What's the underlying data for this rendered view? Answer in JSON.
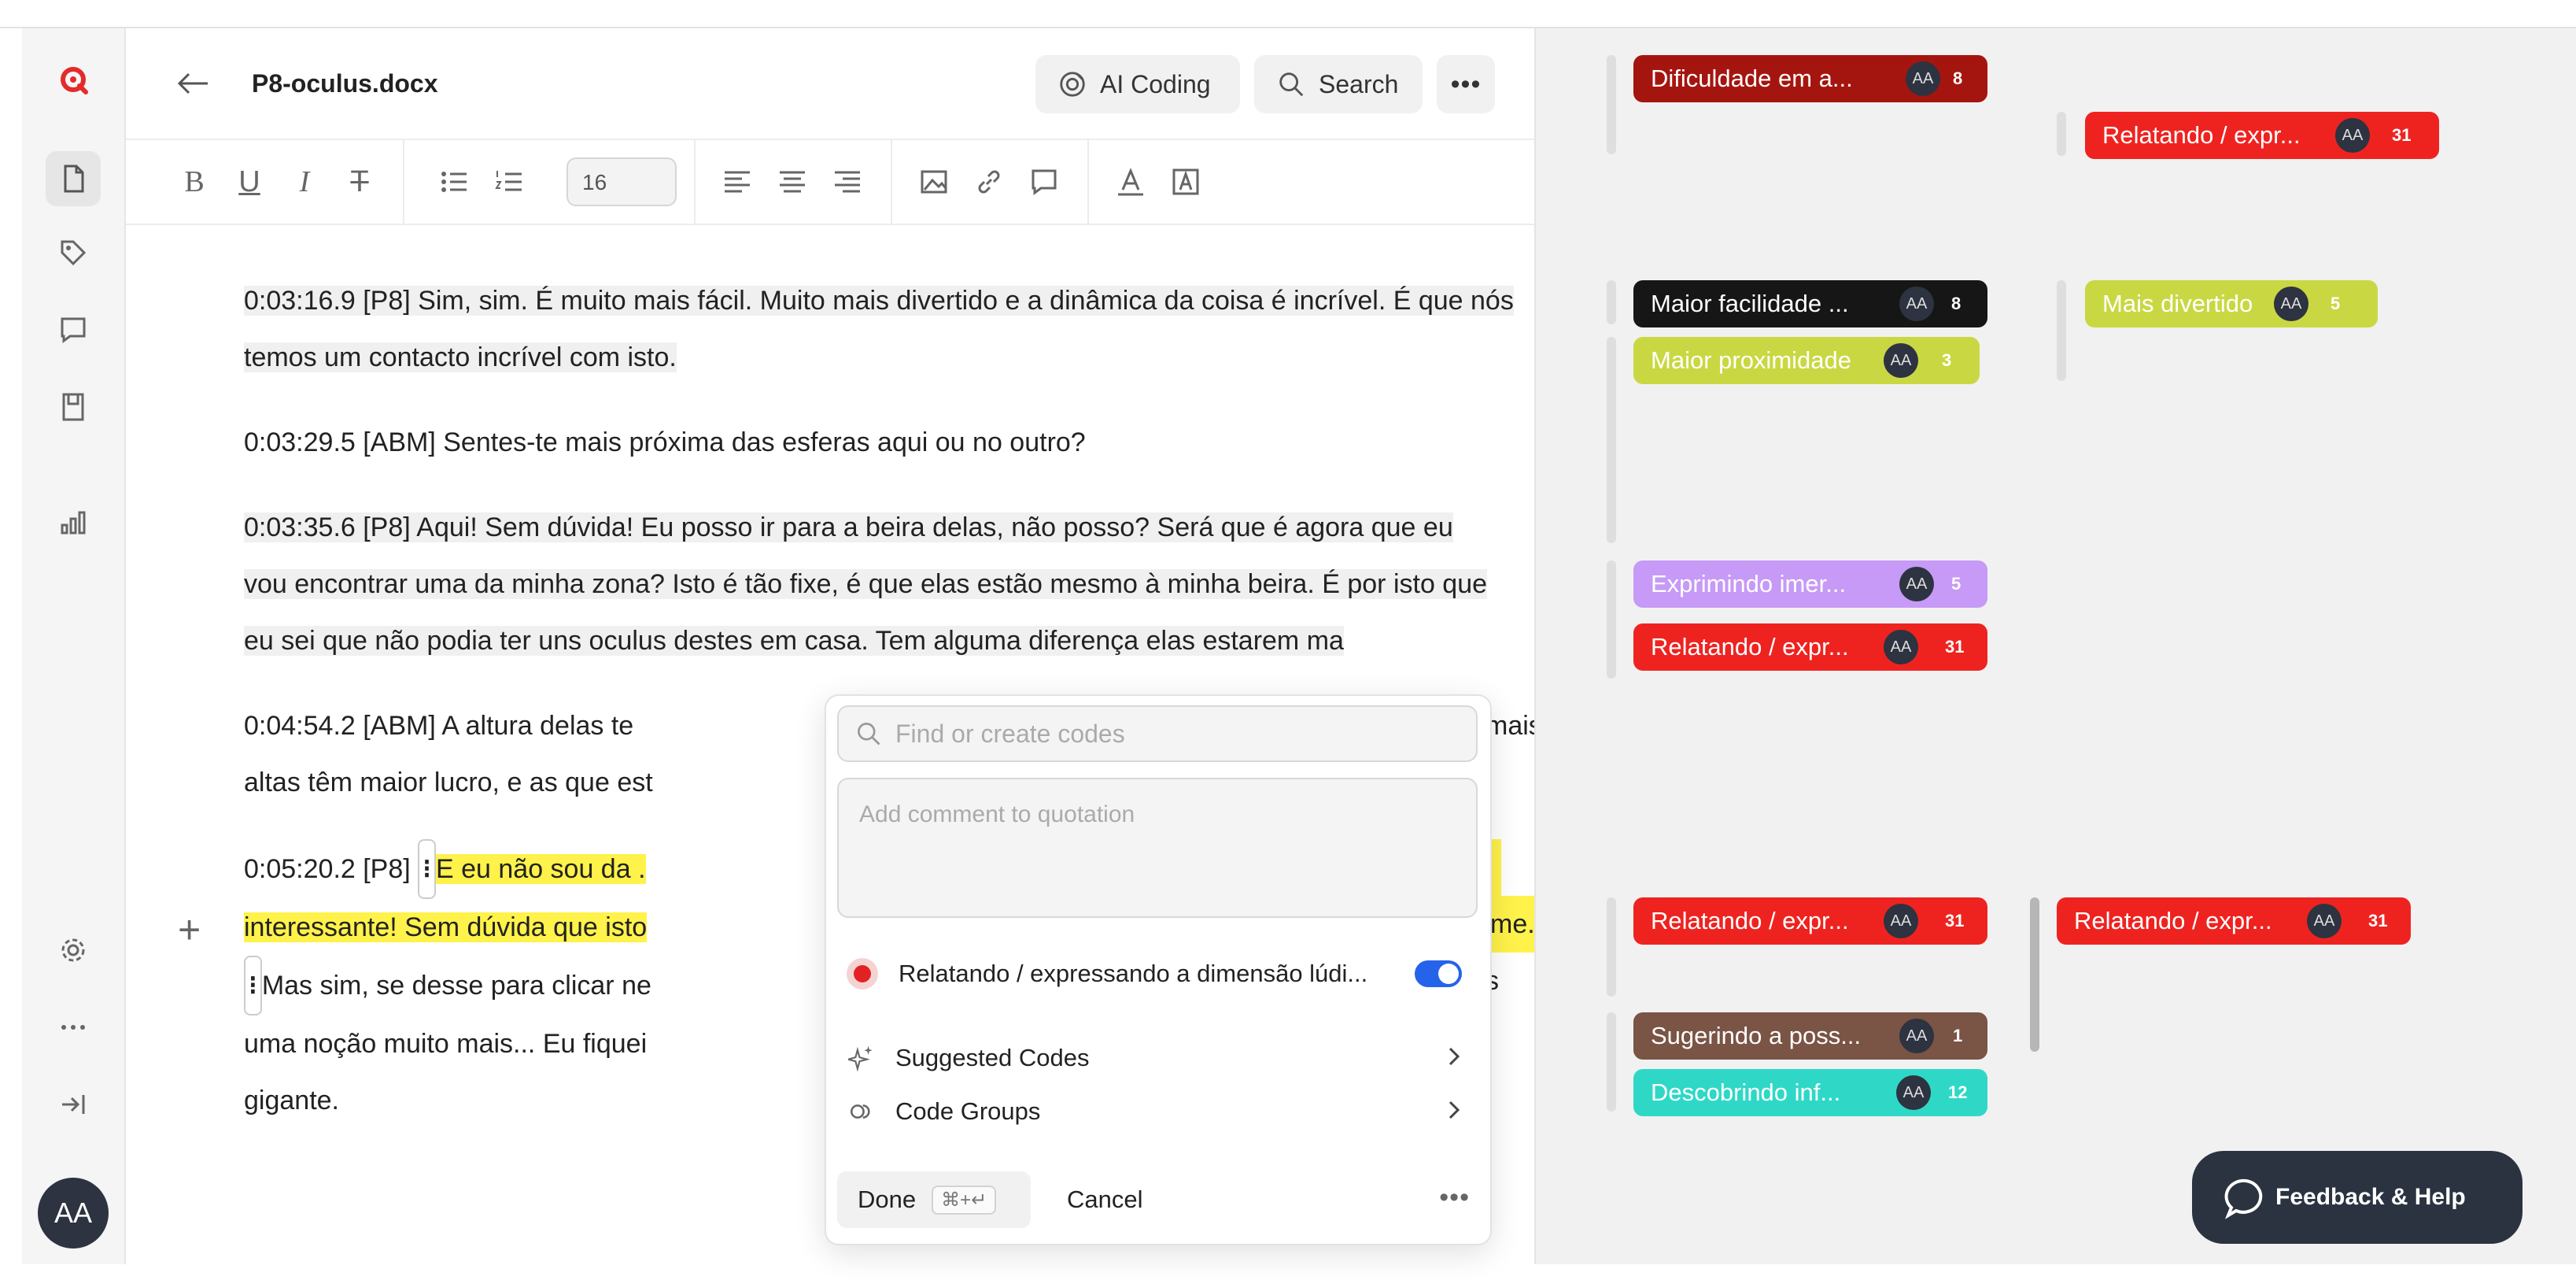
{
  "document": {
    "title": "P8-oculus.docx",
    "font_size": "16",
    "paragraphs": [
      {
        "id": "p1",
        "text": "0:03:16.9 [P8] Sim, sim. É muito mais fácil. Muito mais divertido e a dinâmica da coisa é incrível. É que nós temos um contacto incrível com isto."
      },
      {
        "id": "p2",
        "text": "0:03:29.5 [ABM] Sentes-te mais próxima das esferas aqui ou no outro?"
      },
      {
        "id": "p3",
        "text": "0:03:35.6 [P8] Aqui! Sem dúvida! Eu posso ir para a beira delas, não posso? Será que é agora que eu vou encontrar uma da minha zona? Isto é tão fixe, é que elas estão mesmo à minha beira. É por isto que eu sei que não podia ter uns oculus destes em casa. Tem alguma diferença elas estarem ma"
      },
      {
        "id": "p4a",
        "text": "0:04:54.2 [ABM] A altura delas te"
      },
      {
        "id": "p4b",
        "text": "mais"
      },
      {
        "id": "p4c",
        "text": "altas têm maior lucro, e as que est"
      },
      {
        "id": "p5a",
        "text": "0:05:20.2 [P8] "
      },
      {
        "id": "p5b",
        "text": "E eu não sou da ."
      },
      {
        "id": "p5c",
        "text": "interessante! Sem dúvida que isto"
      },
      {
        "id": "p5d",
        "text": "me."
      },
      {
        "id": "p5e",
        "text": "Mas sim, se desse para clicar ne"
      },
      {
        "id": "p5f",
        "text": "s"
      },
      {
        "id": "p5g",
        "text": "uma noção muito mais... Eu fiquei"
      },
      {
        "id": "p5h",
        "text": "gigante."
      }
    ]
  },
  "header": {
    "ai_coding_label": "AI Coding",
    "search_label": "Search",
    "more_label": "•••"
  },
  "popup": {
    "search_placeholder": "Find or create codes",
    "comment_placeholder": "Add comment to quotation",
    "code_label": "Relatando / expressando a dimensão lúdi...",
    "code_color": "#e22222",
    "code_enabled": true,
    "suggested_codes_label": "Suggested Codes",
    "code_groups_label": "Code Groups",
    "done_label": "Done",
    "done_shortcut": "⌘+↵",
    "cancel_label": "Cancel",
    "more_label": "•••"
  },
  "margin_codes": [
    {
      "label": "Dificuldade em a...",
      "initials": "AA",
      "count": "8",
      "color": "#a5150f"
    },
    {
      "label": "Relatando / expr...",
      "initials": "AA",
      "count": "31",
      "color": "#ee2320"
    },
    {
      "label": "Maior facilidade ...",
      "initials": "AA",
      "count": "8",
      "color": "#161616"
    },
    {
      "label": "Mais divertido",
      "initials": "AA",
      "count": "5",
      "color": "#c9d842"
    },
    {
      "label": "Maior proximidade",
      "initials": "AA",
      "count": "3",
      "color": "#c9d842"
    },
    {
      "label": "Exprimindo imer...",
      "initials": "AA",
      "count": "5",
      "color": "#c69af6"
    },
    {
      "label": "Relatando / expr...",
      "initials": "AA",
      "count": "31",
      "color": "#ee2320"
    },
    {
      "label": "Relatando / expr...",
      "initials": "AA",
      "count": "31",
      "color": "#ee2320"
    },
    {
      "label": "Relatando / expr...",
      "initials": "AA",
      "count": "31",
      "color": "#ee2320"
    },
    {
      "label": "Sugerindo a poss...",
      "initials": "AA",
      "count": "1",
      "color": "#7a5444"
    },
    {
      "label": "Descobrindo inf...",
      "initials": "AA",
      "count": "12",
      "color": "#2fd8c6"
    }
  ],
  "user": {
    "initials": "AA"
  },
  "feedback_label": "Feedback & Help"
}
